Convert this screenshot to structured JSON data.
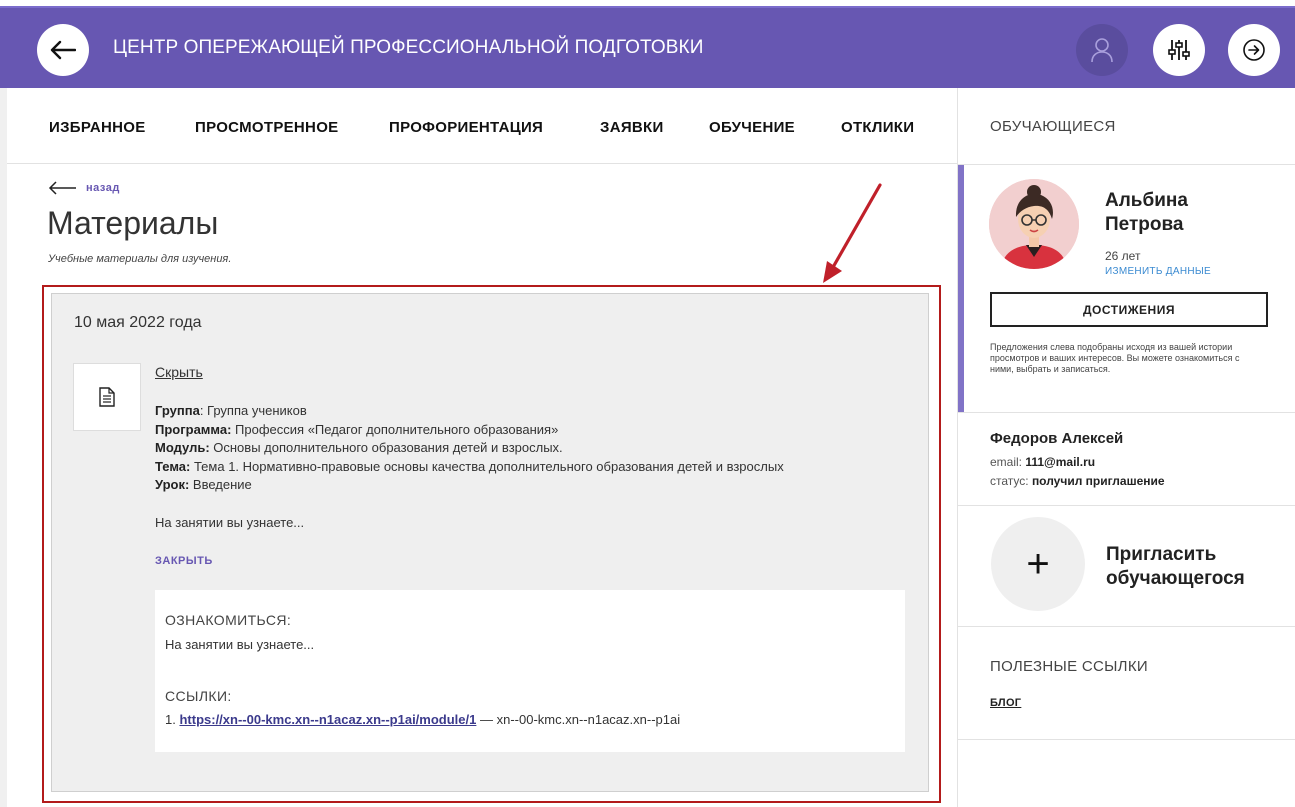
{
  "header": {
    "title": "ЦЕНТР ОПЕРЕЖАЮЩЕЙ ПРОФЕССИОНАЛЬНОЙ ПОДГОТОВКИ",
    "icons": [
      "arrow-left-icon",
      "user-icon",
      "sliders-icon",
      "exit-icon"
    ],
    "brand_color": "#6757b2"
  },
  "nav": {
    "items": [
      "ИЗБРАННОЕ",
      "ПРОСМОТРЕННОЕ",
      "ПРОФОРИЕНТАЦИЯ",
      "ЗАЯВКИ",
      "ОБУЧЕНИЕ",
      "ОТКЛИКИ"
    ]
  },
  "page": {
    "back_label": "назад",
    "title": "Материалы",
    "subtitle": "Учебные материалы для изучения."
  },
  "card": {
    "date": "10 мая 2022 года",
    "hide_label": "Скрыть",
    "group_label": "Группа",
    "group_value": ": Группа учеников",
    "program_label": "Программа:",
    "program_value": " Профессия «Педагог дополнительного образования»",
    "module_label": "Модуль:",
    "module_value": " Основы дополнительного образования детей и взрослых.",
    "topic_label": "Тема:",
    "topic_value": " Тема 1. Нормативно-правовые основы качества дополнительного образования детей и взрослых",
    "lesson_label": "Урок:",
    "lesson_value": " Введение",
    "lesson_text": "На занятии вы узнаете...",
    "close_label": "ЗАКРЫТЬ",
    "inner": {
      "review_heading": "ОЗНАКОМИТЬСЯ:",
      "review_text": "На занятии вы узнаете...",
      "links_heading": "ССЫЛКИ:",
      "link_number": "1. ",
      "link_url": "https://xn--00-kmc.xn--n1acaz.xn--p1ai/module/1",
      "link_desc": " — xn--00-kmc.xn--n1acaz.xn--p1ai"
    },
    "highlight_color": "#b31b1b"
  },
  "sidebar": {
    "title": "ОБУЧАЮЩИЕСЯ",
    "profile": {
      "name": "Альбина Петрова",
      "age": "26 лет",
      "edit_label": "ИЗМЕНИТЬ ДАННЫЕ",
      "achievements_label": "ДОСТИЖЕНИЯ",
      "hint": "Предложения слева подобраны исходя из вашей истории просмотров и ваших интересов. Вы можете ознакомиться с ними, выбрать и записаться."
    },
    "student": {
      "name": "Федоров Алексей",
      "email_label": "email: ",
      "email_value": "111@mail.ru",
      "status_label": "статус: ",
      "status_value": "получил приглашение"
    },
    "invite": {
      "plus": "+",
      "label": "Пригласить обучающегося"
    },
    "links": {
      "title": "ПОЛЕЗНЫЕ ССЫЛКИ",
      "blog_label": "БЛОГ"
    }
  }
}
